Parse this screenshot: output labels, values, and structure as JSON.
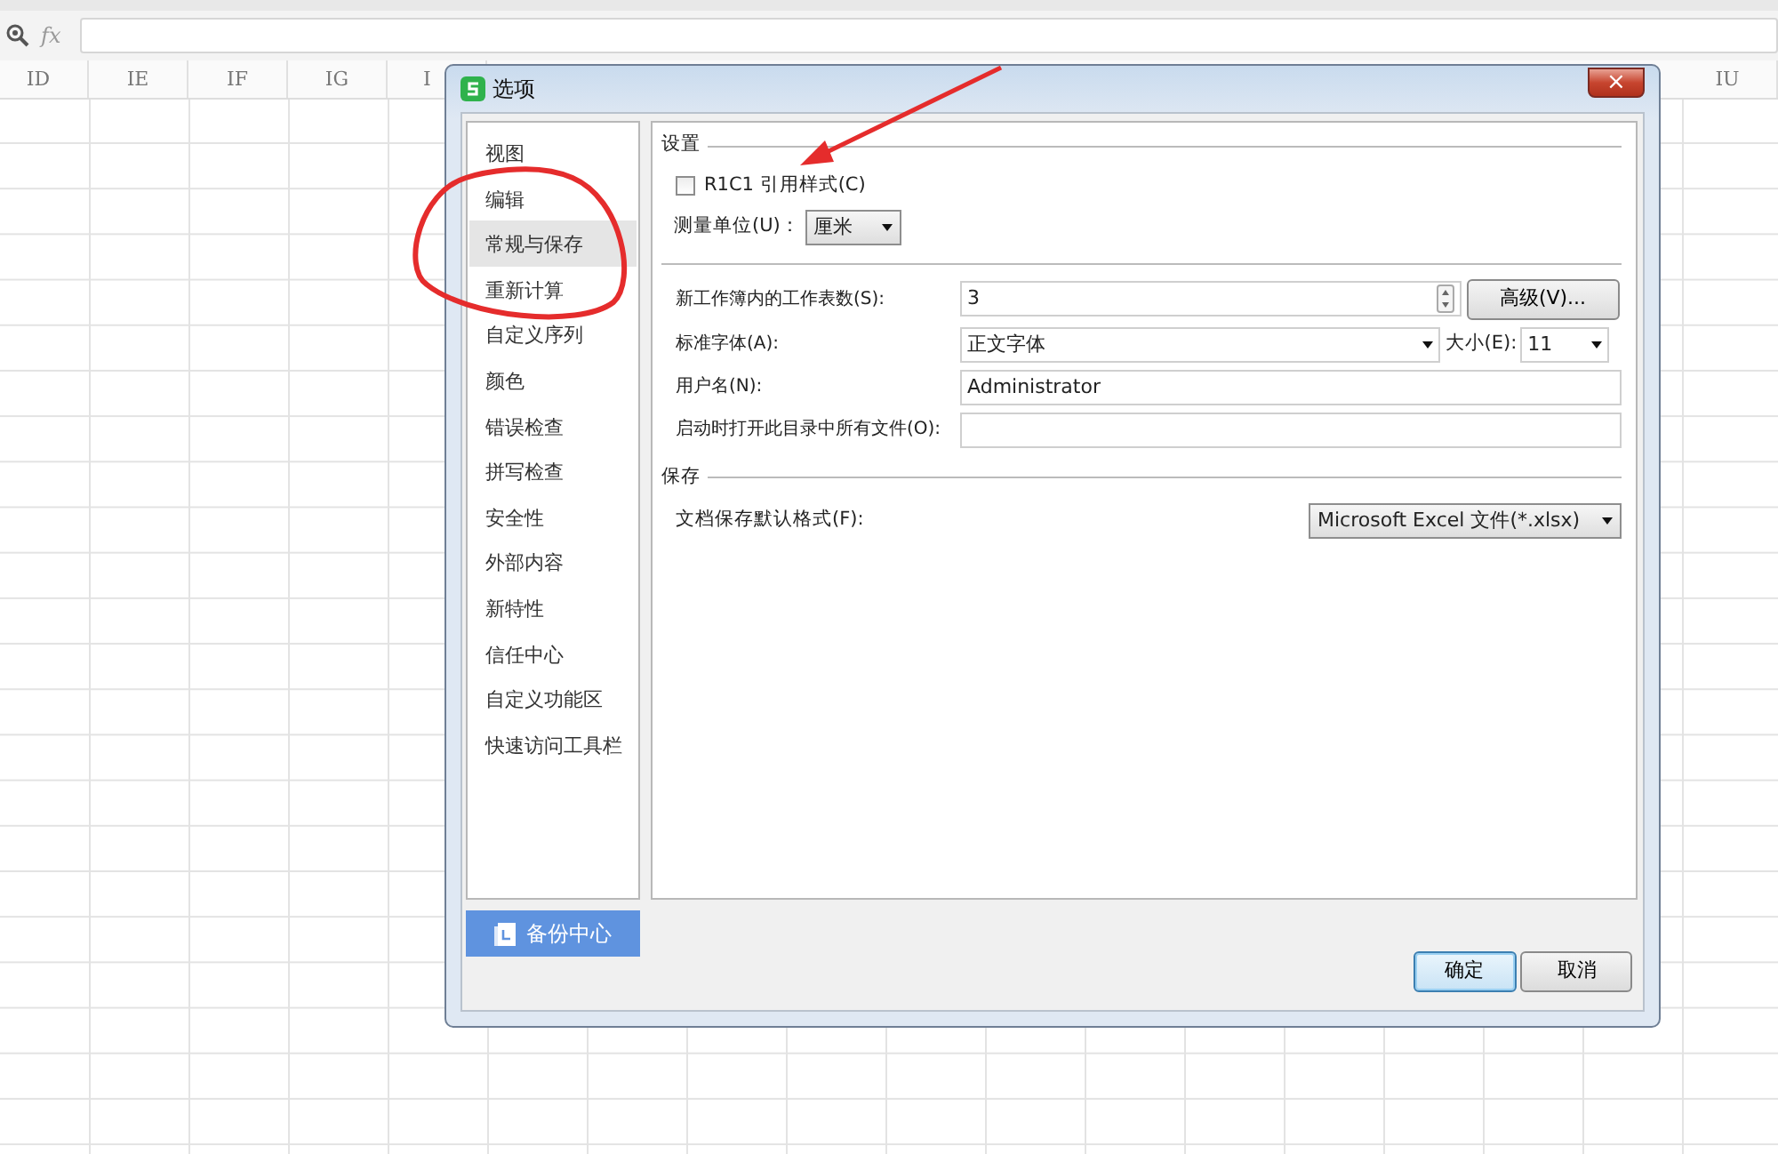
{
  "formula_bar": {
    "function_label": "fx"
  },
  "column_headers": [
    {
      "label": "ID"
    },
    {
      "label": "IE"
    },
    {
      "label": "IF"
    },
    {
      "label": "IG"
    },
    {
      "label": "I"
    },
    {
      "label": "IU"
    }
  ],
  "dialog": {
    "title": "选项",
    "close": "×",
    "sidebar": {
      "items": [
        {
          "label": "视图",
          "selected": false
        },
        {
          "label": "编辑",
          "selected": false
        },
        {
          "label": "常规与保存",
          "selected": true
        },
        {
          "label": "重新计算",
          "selected": false
        },
        {
          "label": "自定义序列",
          "selected": false
        },
        {
          "label": "颜色",
          "selected": false
        },
        {
          "label": "错误检查",
          "selected": false
        },
        {
          "label": "拼写检查",
          "selected": false
        },
        {
          "label": "安全性",
          "selected": false
        },
        {
          "label": "外部内容",
          "selected": false
        },
        {
          "label": "新特性",
          "selected": false
        },
        {
          "label": "信任中心",
          "selected": false
        },
        {
          "label": "自定义功能区",
          "selected": false
        },
        {
          "label": "快速访问工具栏",
          "selected": false
        }
      ]
    },
    "backup_button": "备份中心",
    "settings": {
      "heading": "设置",
      "r1c1": {
        "label": "R1C1 引用样式(C)",
        "checked": false
      },
      "unit": {
        "label": "测量单位(U)：",
        "value": "厘米"
      }
    },
    "general": [
      {
        "kind": "spin",
        "label": "新工作簿内的工作表数(S):",
        "value": "3",
        "button": "高级(V)..."
      },
      {
        "kind": "font",
        "label": "标准字体(A):",
        "value": "正文字体",
        "size_label": "大小(E):",
        "size_value": "11"
      },
      {
        "kind": "text",
        "label": "用户名(N):",
        "value": "Administrator"
      },
      {
        "kind": "text",
        "label": "启动时打开此目录中所有文件(O):"
      }
    ],
    "save": {
      "heading": "保存",
      "format_label": "文档保存默认格式(F):",
      "format_value": "Microsoft Excel 文件(*.xlsx)"
    },
    "buttons": [
      {
        "label": "确定",
        "default": true
      },
      {
        "label": "取消",
        "default": false
      }
    ]
  }
}
